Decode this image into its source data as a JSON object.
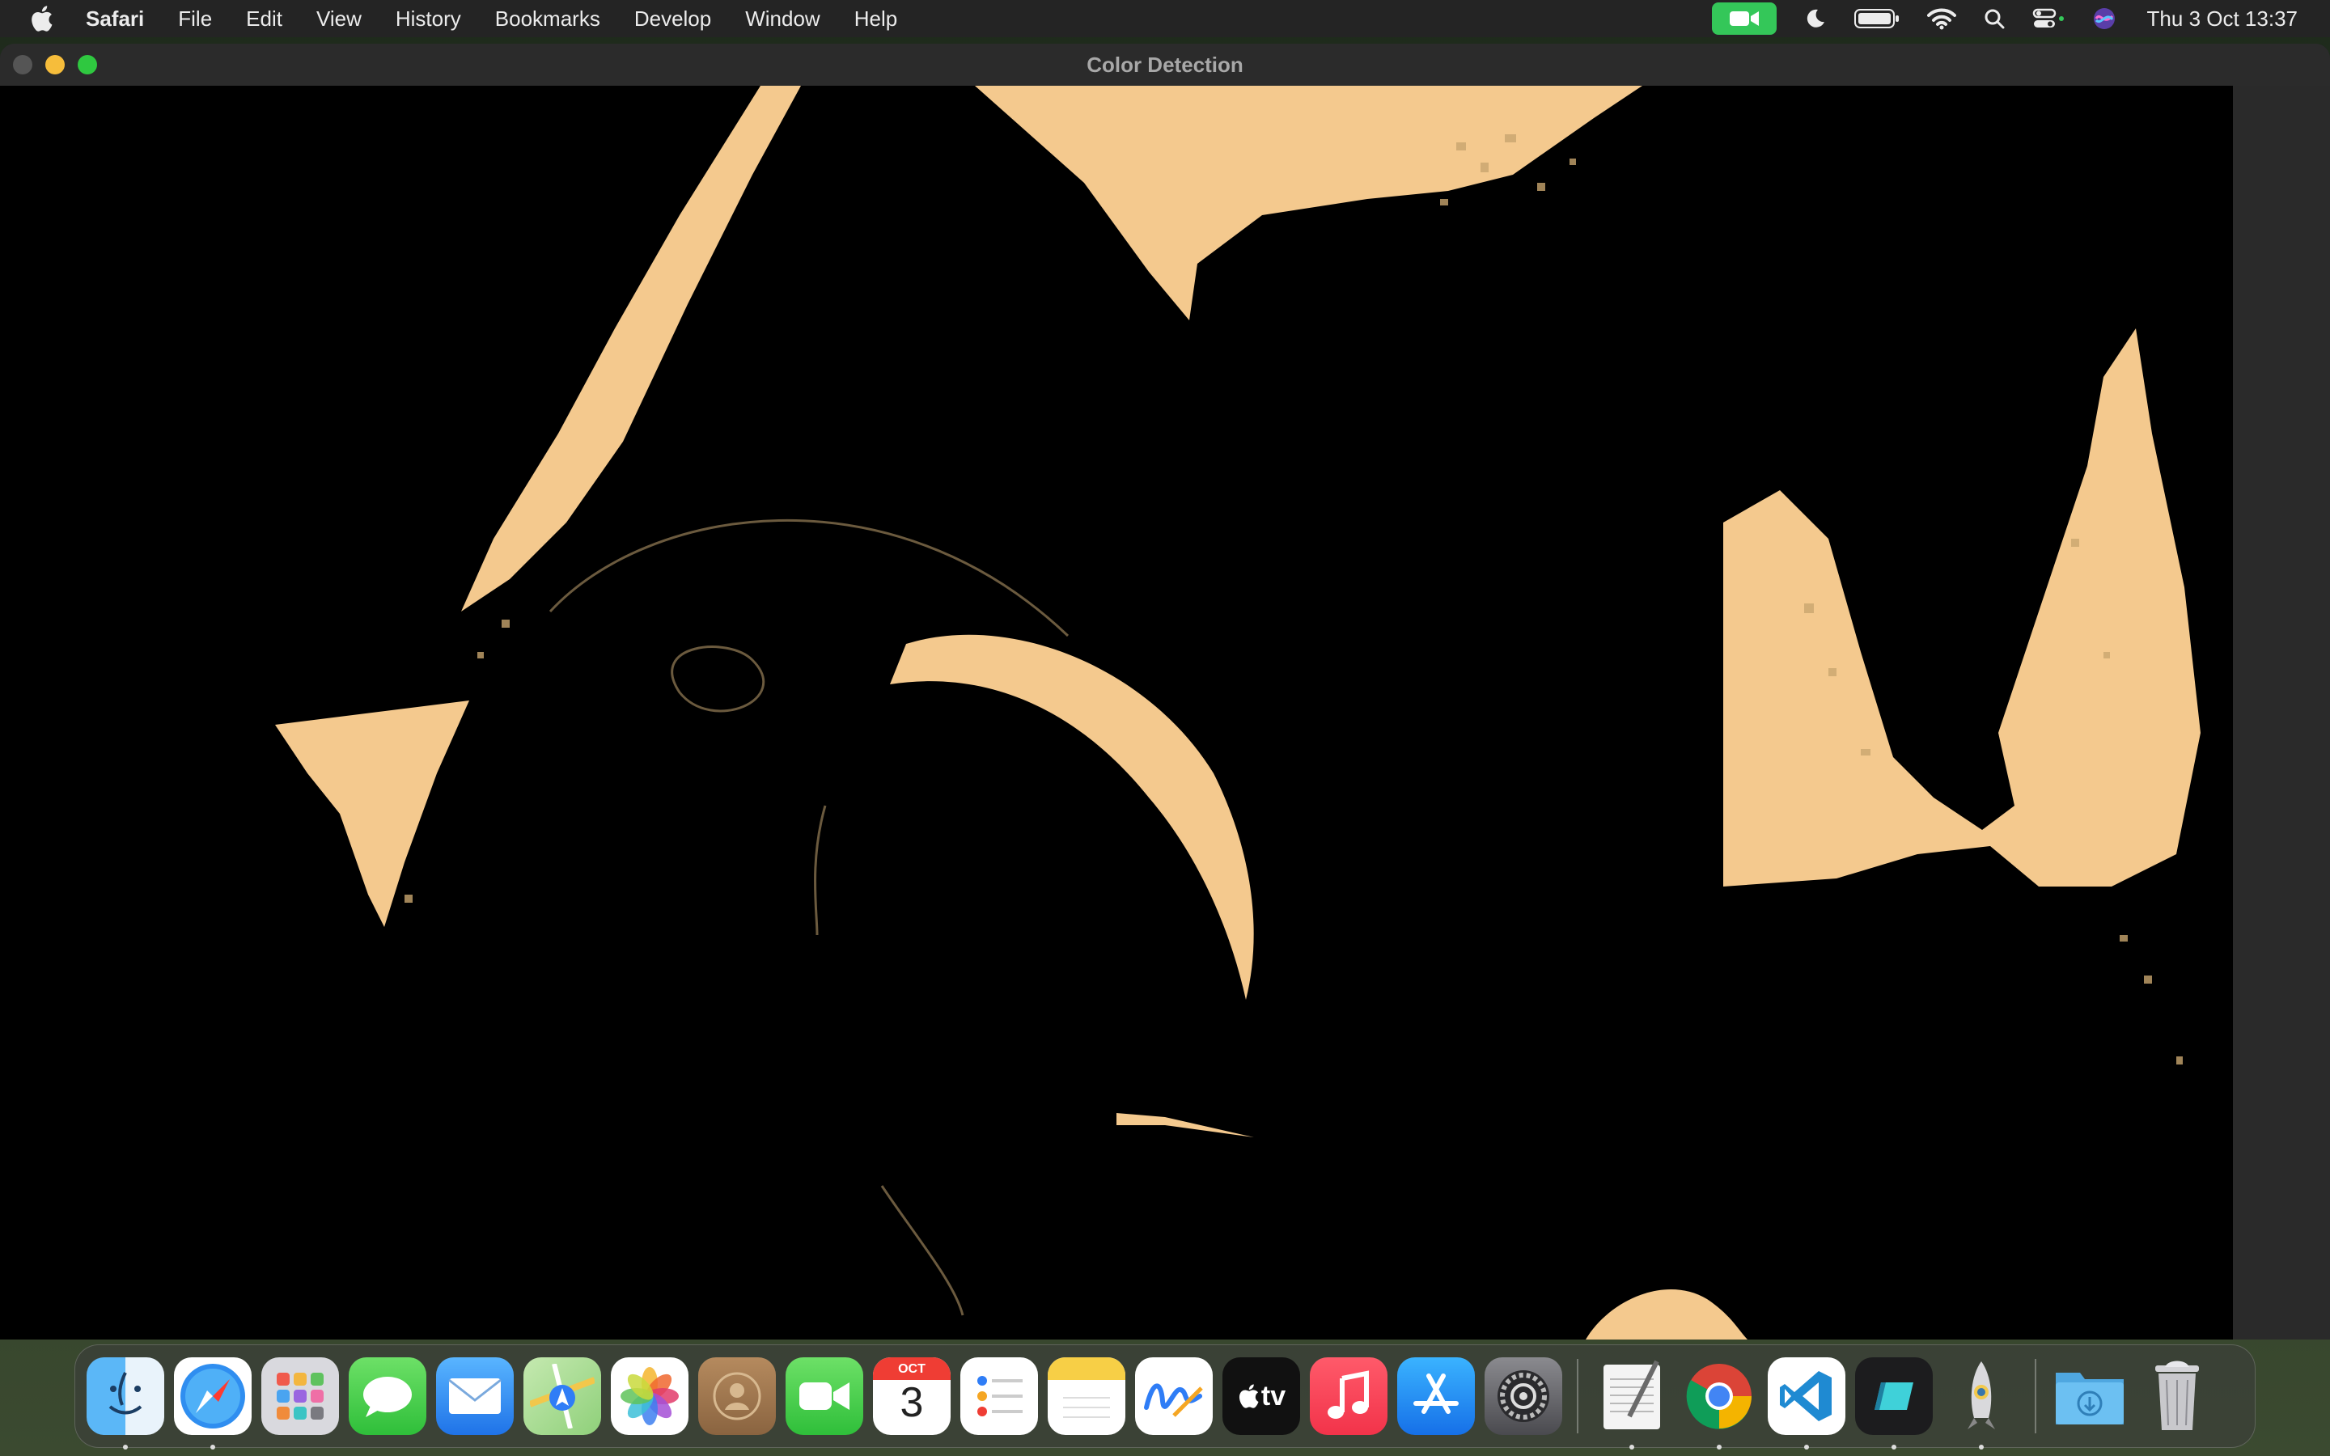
{
  "menubar": {
    "apple_icon": "apple-logo-icon",
    "app_name": "Safari",
    "items": [
      "File",
      "Edit",
      "View",
      "History",
      "Bookmarks",
      "Develop",
      "Window",
      "Help"
    ],
    "status_icons": [
      "facetime-camera-icon",
      "moon-icon",
      "battery-icon",
      "wifi-icon",
      "search-icon",
      "control-center-icon",
      "siri-icon"
    ],
    "clock": "Thu 3 Oct  13:37"
  },
  "window": {
    "title": "Color Detection",
    "content": "camera-frame-color-mask",
    "mask_color": "#f4c98e"
  },
  "dock": {
    "apps": [
      {
        "name": "Finder",
        "icon": "finder-icon",
        "running": true
      },
      {
        "name": "Safari",
        "icon": "safari-icon",
        "running": true
      },
      {
        "name": "Launchpad",
        "icon": "launchpad-icon",
        "running": false
      },
      {
        "name": "Messages",
        "icon": "messages-icon",
        "running": false
      },
      {
        "name": "Mail",
        "icon": "mail-icon",
        "running": false
      },
      {
        "name": "Maps",
        "icon": "maps-icon",
        "running": false
      },
      {
        "name": "Photos",
        "icon": "photos-icon",
        "running": false
      },
      {
        "name": "Contacts",
        "icon": "contacts-icon",
        "running": false
      },
      {
        "name": "FaceTime",
        "icon": "facetime-icon",
        "running": false
      },
      {
        "name": "Calendar",
        "icon": "calendar-icon",
        "running": false
      },
      {
        "name": "Reminders",
        "icon": "reminders-icon",
        "running": false
      },
      {
        "name": "Notes",
        "icon": "notes-icon",
        "running": false
      },
      {
        "name": "Freeform",
        "icon": "freeform-icon",
        "running": false
      },
      {
        "name": "TV",
        "icon": "apple-tv-icon",
        "running": false
      },
      {
        "name": "Music",
        "icon": "music-icon",
        "running": false
      },
      {
        "name": "App Store",
        "icon": "app-store-icon",
        "running": false
      },
      {
        "name": "System Settings",
        "icon": "settings-icon",
        "running": false
      },
      {
        "name": "TextEdit",
        "icon": "textedit-icon",
        "running": true
      },
      {
        "name": "Chrome",
        "icon": "chrome-icon",
        "running": true
      },
      {
        "name": "VS Code",
        "icon": "vscode-icon",
        "running": true
      },
      {
        "name": "Cursor",
        "icon": "cursor-app-icon",
        "running": true
      },
      {
        "name": "Python Launcher",
        "icon": "python-rocket-icon",
        "running": true
      },
      {
        "name": "Downloads",
        "icon": "downloads-folder-icon",
        "running": false
      },
      {
        "name": "Trash",
        "icon": "trash-icon",
        "running": false
      }
    ],
    "calendar_month": "OCT",
    "calendar_day": "3",
    "tv_label": "tv"
  }
}
